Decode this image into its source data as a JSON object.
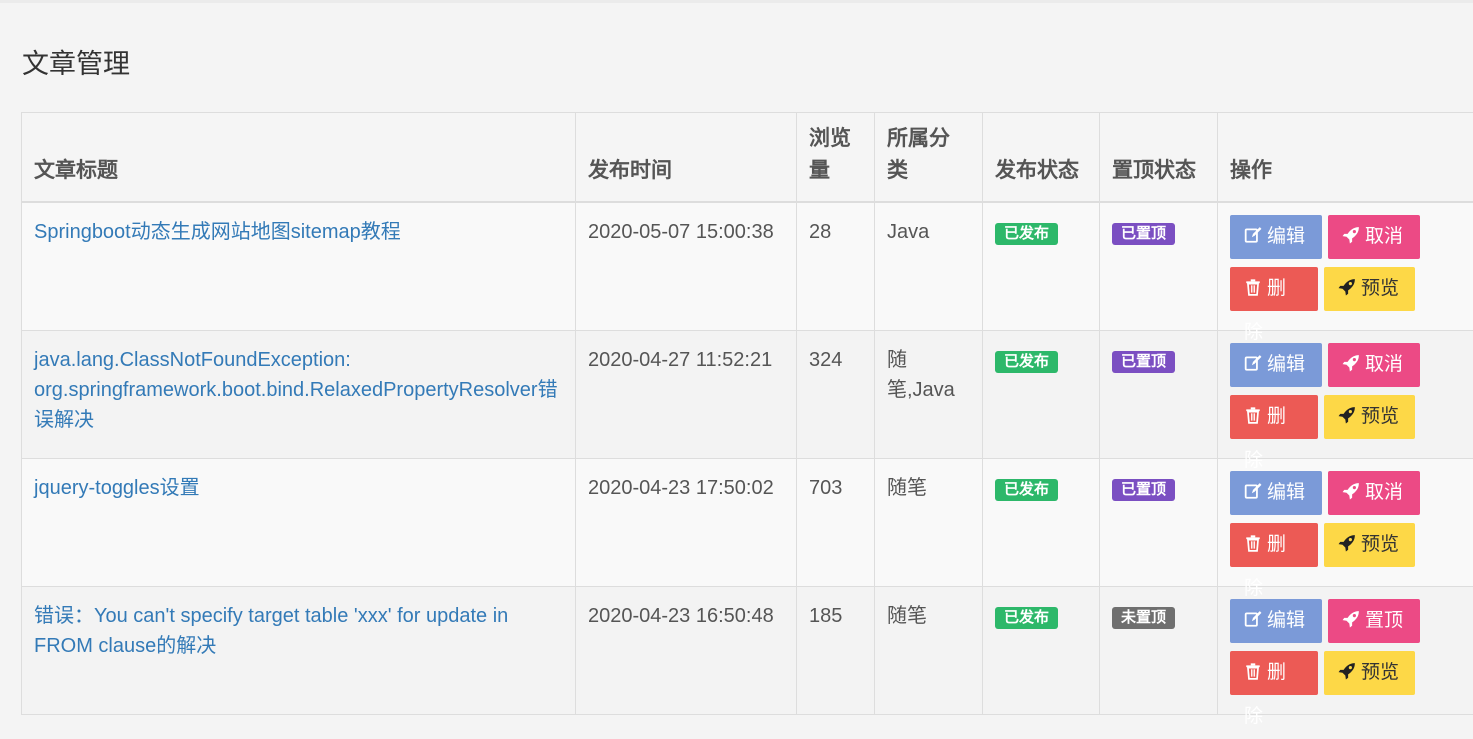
{
  "page": {
    "title": "文章管理"
  },
  "table": {
    "headers": [
      "文章标题",
      "发布时间",
      "浏览量",
      "所属分类",
      "发布状态",
      "置顶状态",
      "操作"
    ],
    "rows": [
      {
        "title": "Springboot动态生成网站地图sitemap教程",
        "date": "2020-05-07 15:00:38",
        "views": "28",
        "category": "Java",
        "publish_status": "已发布",
        "top_status": "已置顶",
        "top_status_color": "#7b4fc2",
        "actions": {
          "edit": "编辑",
          "toggle_top": "取消",
          "delete": "删除",
          "preview": "预览"
        }
      },
      {
        "title": "java.lang.ClassNotFoundException: org.springframework.boot.bind.RelaxedPropertyResolver错误解决",
        "date": "2020-04-27 11:52:21",
        "views": "324",
        "category": "随笔,Java",
        "publish_status": "已发布",
        "top_status": "已置顶",
        "top_status_color": "#7b4fc2",
        "actions": {
          "edit": "编辑",
          "toggle_top": "取消",
          "delete": "删除",
          "preview": "预览"
        }
      },
      {
        "title": "jquery-toggles设置",
        "date": "2020-04-23 17:50:02",
        "views": "703",
        "category": "随笔",
        "publish_status": "已发布",
        "top_status": "已置顶",
        "top_status_color": "#7b4fc2",
        "actions": {
          "edit": "编辑",
          "toggle_top": "取消",
          "delete": "删除",
          "preview": "预览"
        }
      },
      {
        "title": "错误：You can't specify target table 'xxx' for update in FROM clause的解决",
        "date": "2020-04-23 16:50:48",
        "views": "185",
        "category": "随笔",
        "publish_status": "已发布",
        "top_status": "未置顶",
        "top_status_color": "#6f6f6f",
        "actions": {
          "edit": "编辑",
          "toggle_top": "置顶",
          "delete": "删除",
          "preview": "预览"
        }
      }
    ]
  },
  "colors": {
    "link": "#337ab7",
    "published_badge": "#2db86a",
    "edit_button": "#7b9ad8",
    "top_button": "#ec4a85",
    "delete_button": "#ec5a55",
    "preview_button": "#fdd847"
  },
  "icons": {
    "edit": "edit-icon",
    "toggle_top": "rocket-icon",
    "delete": "trash-icon",
    "preview": "rocket-icon"
  }
}
